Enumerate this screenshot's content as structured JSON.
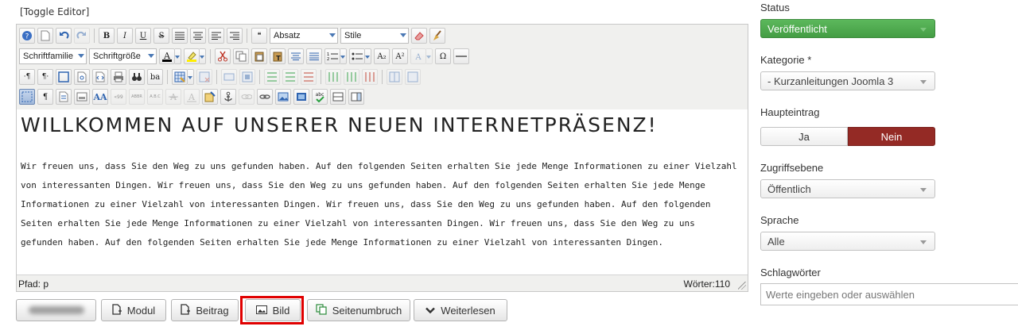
{
  "editor": {
    "toggle_label": "[Toggle Editor]",
    "toolbar": {
      "format_select": "Absatz",
      "style_select": "Stile",
      "font_family_select": "Schriftfamilie",
      "font_size_select": "Schriftgröße",
      "subscript_label": "A₂",
      "superscript_label": "A²",
      "omega_label": "Ω",
      "bold_label": "B",
      "italic_label": "I",
      "underline_label": "U",
      "strike_label": "S",
      "quote_label": "❝",
      "ltr_label": "·¶",
      "rtl_label": "¶·",
      "ba_label": "ba",
      "pilcrow_label": "¶",
      "aa_label": "AA",
      "quote_text_label": "«99",
      "abbr_label": "ABBR",
      "acronym_label": "A.B.C",
      "abc_label": "abc"
    },
    "content": {
      "heading": "WILLKOMMEN AUF UNSERER NEUEN INTERNETPRÄSENZ!",
      "paragraph": "Wir freuen uns, dass Sie den Weg zu uns gefunden haben. Auf den folgenden Seiten erhalten Sie jede Menge Informationen zu einer Vielzahl von interessanten Dingen. Wir freuen uns, dass Sie den Weg zu uns gefunden haben. Auf den folgenden Seiten erhalten Sie jede Menge Informationen zu einer Vielzahl von interessanten Dingen. Wir freuen uns, dass Sie den Weg zu uns gefunden haben. Auf den folgenden Seiten erhalten Sie jede Menge Informationen zu einer Vielzahl von interessanten Dingen. Wir freuen uns, dass Sie den Weg zu uns gefunden haben. Auf den folgenden Seiten erhalten Sie jede Menge Informationen zu einer Vielzahl von interessanten Dingen."
    },
    "status": {
      "path": "Pfad:  p",
      "words": "Wörter:110"
    }
  },
  "buttons": {
    "module": "Modul",
    "article": "Beitrag",
    "image": "Bild",
    "pagebreak": "Seitenumbruch",
    "readmore": "Weiterlesen"
  },
  "sidebar": {
    "status": {
      "label": "Status",
      "value": "Veröffentlicht"
    },
    "category": {
      "label": "Kategorie *",
      "value": "- Kurzanleitungen Joomla 3"
    },
    "featured": {
      "label": "Haupteintrag",
      "yes": "Ja",
      "no": "Nein"
    },
    "access": {
      "label": "Zugriffsebene",
      "value": "Öffentlich"
    },
    "language": {
      "label": "Sprache",
      "value": "Alle"
    },
    "tags": {
      "label": "Schlagwörter",
      "placeholder": "Werte eingeben oder auswählen"
    }
  },
  "colors": {
    "published_green": "#5cb85c",
    "no_red": "#942a25",
    "highlight": "#e00000"
  }
}
